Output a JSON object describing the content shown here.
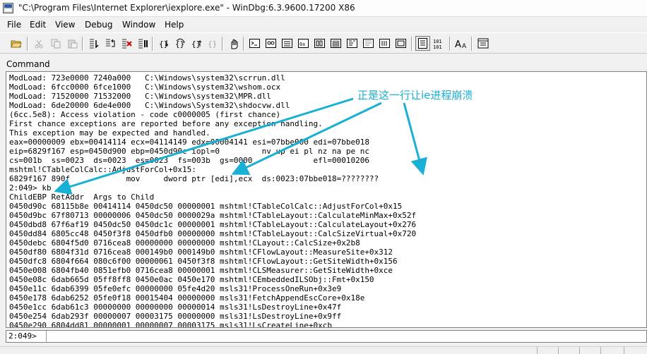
{
  "window": {
    "title": "\"C:\\Program Files\\Internet Explorer\\iexplore.exe\" - WinDbg:6.3.9600.17200 X86"
  },
  "menu": [
    "File",
    "Edit",
    "View",
    "Debug",
    "Window",
    "Help"
  ],
  "toolbar": {
    "icons": [
      "open-folder-icon",
      "cut-icon",
      "copy-icon",
      "paste-icon",
      "go-icon",
      "restart-icon",
      "stop-debugging-icon",
      "break-icon",
      "step-into-icon",
      "step-over-icon",
      "step-out-icon",
      "run-to-cursor-icon",
      "source-mode-icon",
      "command-icon",
      "watch-icon",
      "locals-icon",
      "registers-icon",
      "memory-icon",
      "call-stack-icon",
      "disassembly-icon",
      "scratch-pad-icon",
      "source-toggle-icon",
      "hex-toggle-icon",
      "font-icon",
      "options-icon"
    ]
  },
  "pane": {
    "title": "Command"
  },
  "output": {
    "lines": [
      "ModLoad: 723e0000 7240a000   C:\\Windows\\system32\\scrrun.dll",
      "ModLoad: 6fcc0000 6fce1000   C:\\Windows\\system32\\wshom.ocx",
      "ModLoad: 71520000 71532000   C:\\Windows\\system32\\MPR.dll",
      "ModLoad: 6de20000 6de4e000   C:\\Windows\\System32\\shdocvw.dll",
      "(6cc.5e8): Access violation - code c0000005 (first chance)",
      "First chance exceptions are reported before any exception handling.",
      "This exception may be expected and handled.",
      "eax=00000009 ebx=00414114 ecx=04114149 edx=00004141 esi=07bbe000 edi=07bbe018",
      "eip=6829f167 esp=0450d900 ebp=0450d90c iopl=0         nv up ei pl nz na pe nc",
      "cs=001b  ss=0023  ds=0023  es=0023  fs=003b  gs=0000             efl=00010206",
      "mshtml!CTableColCalc::AdjustForCol+0x15:",
      "6829f167 890f            mov     dword ptr [edi],ecx  ds:0023:07bbe018=????????",
      "2:049> kb",
      "ChildEBP RetAddr  Args to Child",
      "0450d90c 68115b8e 00414114 0450dc50 00000001 mshtml!CTableColCalc::AdjustForCol+0x15",
      "0450d9bc 67f80713 00000006 0450dc50 0000029a mshtml!CTableLayout::CalculateMinMax+0x52f",
      "0450dbd8 67f6af19 0450dc50 0450dc1c 00000001 mshtml!CTableLayout::CalculateLayout+0x276",
      "0450dd84 6805cc48 0450f3f8 0450dfb0 00000000 mshtml!CTableLayout::CalcSizeVirtual+0x720",
      "0450debc 6804f5d0 0716cea8 00000000 00000000 mshtml!CLayout::CalcSize+0x2b8",
      "0450df80 6804f31d 0716cea8 000149b0 000149b0 mshtml!CFlowLayout::MeasureSite+0x312",
      "0450dfc8 6804f664 080c6f00 00000061 0450f3f8 mshtml!CFlowLayout::GetSiteWidth+0x156",
      "0450e008 6804fb40 0851efb0 0716cea8 00000001 mshtml!CLSMeasurer::GetSiteWidth+0xce",
      "0450e08c 6dab665d 05ff8ff8 0450e0ac 0450e170 mshtml!CEmbeddedILSObj::Fmt+0x150",
      "0450e11c 6dab6399 05fe0efc 00000000 05fe4d20 msls31!ProcessOneRun+0x3e9",
      "0450e178 6dab6252 05fe0f18 00015404 00000000 msls31!FetchAppendEscCore+0x18e",
      "0450e1cc 6dab61c3 00000000 00000000 00000014 msls31!LsDestroyLine+0x47f",
      "0450e254 6dab293f 00000007 00003175 00000000 msls31!LsDestroyLine+0x9ff",
      "0450e290 6804dd81 00000001 00000007 00003175 msls31!LsCreateLine+0xcb"
    ]
  },
  "command": {
    "prompt": "2:049>",
    "value": ""
  },
  "status": {
    "cells": [
      "",
      "",
      "",
      "",
      ""
    ]
  },
  "annotation": {
    "text": "正是这一行让ie进程崩溃",
    "color": "#18b0d4"
  }
}
